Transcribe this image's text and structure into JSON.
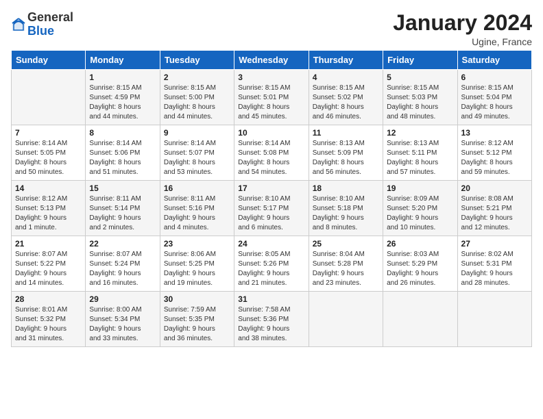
{
  "header": {
    "logo_general": "General",
    "logo_blue": "Blue",
    "month": "January 2024",
    "location": "Ugine, France"
  },
  "days_of_week": [
    "Sunday",
    "Monday",
    "Tuesday",
    "Wednesday",
    "Thursday",
    "Friday",
    "Saturday"
  ],
  "weeks": [
    [
      {
        "day": "",
        "info": ""
      },
      {
        "day": "1",
        "info": "Sunrise: 8:15 AM\nSunset: 4:59 PM\nDaylight: 8 hours\nand 44 minutes."
      },
      {
        "day": "2",
        "info": "Sunrise: 8:15 AM\nSunset: 5:00 PM\nDaylight: 8 hours\nand 44 minutes."
      },
      {
        "day": "3",
        "info": "Sunrise: 8:15 AM\nSunset: 5:01 PM\nDaylight: 8 hours\nand 45 minutes."
      },
      {
        "day": "4",
        "info": "Sunrise: 8:15 AM\nSunset: 5:02 PM\nDaylight: 8 hours\nand 46 minutes."
      },
      {
        "day": "5",
        "info": "Sunrise: 8:15 AM\nSunset: 5:03 PM\nDaylight: 8 hours\nand 48 minutes."
      },
      {
        "day": "6",
        "info": "Sunrise: 8:15 AM\nSunset: 5:04 PM\nDaylight: 8 hours\nand 49 minutes."
      }
    ],
    [
      {
        "day": "7",
        "info": "Sunrise: 8:14 AM\nSunset: 5:05 PM\nDaylight: 8 hours\nand 50 minutes."
      },
      {
        "day": "8",
        "info": "Sunrise: 8:14 AM\nSunset: 5:06 PM\nDaylight: 8 hours\nand 51 minutes."
      },
      {
        "day": "9",
        "info": "Sunrise: 8:14 AM\nSunset: 5:07 PM\nDaylight: 8 hours\nand 53 minutes."
      },
      {
        "day": "10",
        "info": "Sunrise: 8:14 AM\nSunset: 5:08 PM\nDaylight: 8 hours\nand 54 minutes."
      },
      {
        "day": "11",
        "info": "Sunrise: 8:13 AM\nSunset: 5:09 PM\nDaylight: 8 hours\nand 56 minutes."
      },
      {
        "day": "12",
        "info": "Sunrise: 8:13 AM\nSunset: 5:11 PM\nDaylight: 8 hours\nand 57 minutes."
      },
      {
        "day": "13",
        "info": "Sunrise: 8:12 AM\nSunset: 5:12 PM\nDaylight: 8 hours\nand 59 minutes."
      }
    ],
    [
      {
        "day": "14",
        "info": "Sunrise: 8:12 AM\nSunset: 5:13 PM\nDaylight: 9 hours\nand 1 minute."
      },
      {
        "day": "15",
        "info": "Sunrise: 8:11 AM\nSunset: 5:14 PM\nDaylight: 9 hours\nand 2 minutes."
      },
      {
        "day": "16",
        "info": "Sunrise: 8:11 AM\nSunset: 5:16 PM\nDaylight: 9 hours\nand 4 minutes."
      },
      {
        "day": "17",
        "info": "Sunrise: 8:10 AM\nSunset: 5:17 PM\nDaylight: 9 hours\nand 6 minutes."
      },
      {
        "day": "18",
        "info": "Sunrise: 8:10 AM\nSunset: 5:18 PM\nDaylight: 9 hours\nand 8 minutes."
      },
      {
        "day": "19",
        "info": "Sunrise: 8:09 AM\nSunset: 5:20 PM\nDaylight: 9 hours\nand 10 minutes."
      },
      {
        "day": "20",
        "info": "Sunrise: 8:08 AM\nSunset: 5:21 PM\nDaylight: 9 hours\nand 12 minutes."
      }
    ],
    [
      {
        "day": "21",
        "info": "Sunrise: 8:07 AM\nSunset: 5:22 PM\nDaylight: 9 hours\nand 14 minutes."
      },
      {
        "day": "22",
        "info": "Sunrise: 8:07 AM\nSunset: 5:24 PM\nDaylight: 9 hours\nand 16 minutes."
      },
      {
        "day": "23",
        "info": "Sunrise: 8:06 AM\nSunset: 5:25 PM\nDaylight: 9 hours\nand 19 minutes."
      },
      {
        "day": "24",
        "info": "Sunrise: 8:05 AM\nSunset: 5:26 PM\nDaylight: 9 hours\nand 21 minutes."
      },
      {
        "day": "25",
        "info": "Sunrise: 8:04 AM\nSunset: 5:28 PM\nDaylight: 9 hours\nand 23 minutes."
      },
      {
        "day": "26",
        "info": "Sunrise: 8:03 AM\nSunset: 5:29 PM\nDaylight: 9 hours\nand 26 minutes."
      },
      {
        "day": "27",
        "info": "Sunrise: 8:02 AM\nSunset: 5:31 PM\nDaylight: 9 hours\nand 28 minutes."
      }
    ],
    [
      {
        "day": "28",
        "info": "Sunrise: 8:01 AM\nSunset: 5:32 PM\nDaylight: 9 hours\nand 31 minutes."
      },
      {
        "day": "29",
        "info": "Sunrise: 8:00 AM\nSunset: 5:34 PM\nDaylight: 9 hours\nand 33 minutes."
      },
      {
        "day": "30",
        "info": "Sunrise: 7:59 AM\nSunset: 5:35 PM\nDaylight: 9 hours\nand 36 minutes."
      },
      {
        "day": "31",
        "info": "Sunrise: 7:58 AM\nSunset: 5:36 PM\nDaylight: 9 hours\nand 38 minutes."
      },
      {
        "day": "",
        "info": ""
      },
      {
        "day": "",
        "info": ""
      },
      {
        "day": "",
        "info": ""
      }
    ]
  ]
}
